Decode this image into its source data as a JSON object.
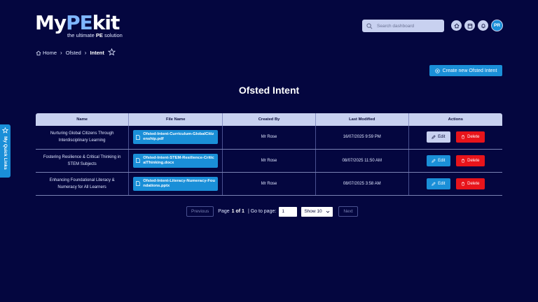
{
  "brand": {
    "logo_text": "MyPEkit",
    "tagline_pre": "the ultimate ",
    "tagline_bold": "PE",
    "tagline_post": " solution"
  },
  "search": {
    "placeholder": "Search dashboard"
  },
  "header": {
    "icons": [
      "home-icon",
      "calendar-icon",
      "bell-icon"
    ],
    "avatar_initials": "PR"
  },
  "breadcrumb": {
    "home": "Home",
    "section": "Ofsted",
    "current": "Intent"
  },
  "create_button": {
    "label": "Create new Ofsted Intent"
  },
  "page_title": "Ofsted Intent",
  "table": {
    "headers": [
      "Name",
      "File Name",
      "Created By",
      "Last Modified",
      "Actions"
    ],
    "rows": [
      {
        "name": "Nurturing Global Citizens Through Interdisciplinary Learning",
        "file": "Ofsted-Intent-Curriculum-GlobalCitizenship.pdf",
        "created_by": "Mr Rose",
        "modified": "16/07/2025 9:59 PM"
      },
      {
        "name": "Fostering Resilience & Critical Thinking in STEM Subjects",
        "file": "Ofsted-Intent-STEM-Resilience-CriticalThinking.docx",
        "created_by": "Mr Rose",
        "modified": "08/07/2025 11:50 AM"
      },
      {
        "name": "Enhancing Foundational Literacy & Numeracy for All Learners",
        "file": "Ofsted-Intent-Literacy-Numeracy-Foundations.pptx",
        "created_by": "Mr Rose",
        "modified": "08/07/2025 3:58 AM"
      }
    ],
    "edit_label": "Edit",
    "delete_label": "Delete"
  },
  "pagination": {
    "previous": "Previous",
    "page_prefix": "Page",
    "page_current": "1 of 1",
    "goto_label": "| Go to page:",
    "goto_value": "1",
    "show_label": "Show 10",
    "next": "Next"
  },
  "quick_links": {
    "label": "My Quick Links"
  },
  "colors": {
    "background": "#04063f",
    "accent": "#1a8fd8",
    "header_row": "#c8d1f0",
    "danger": "#e8141b"
  }
}
